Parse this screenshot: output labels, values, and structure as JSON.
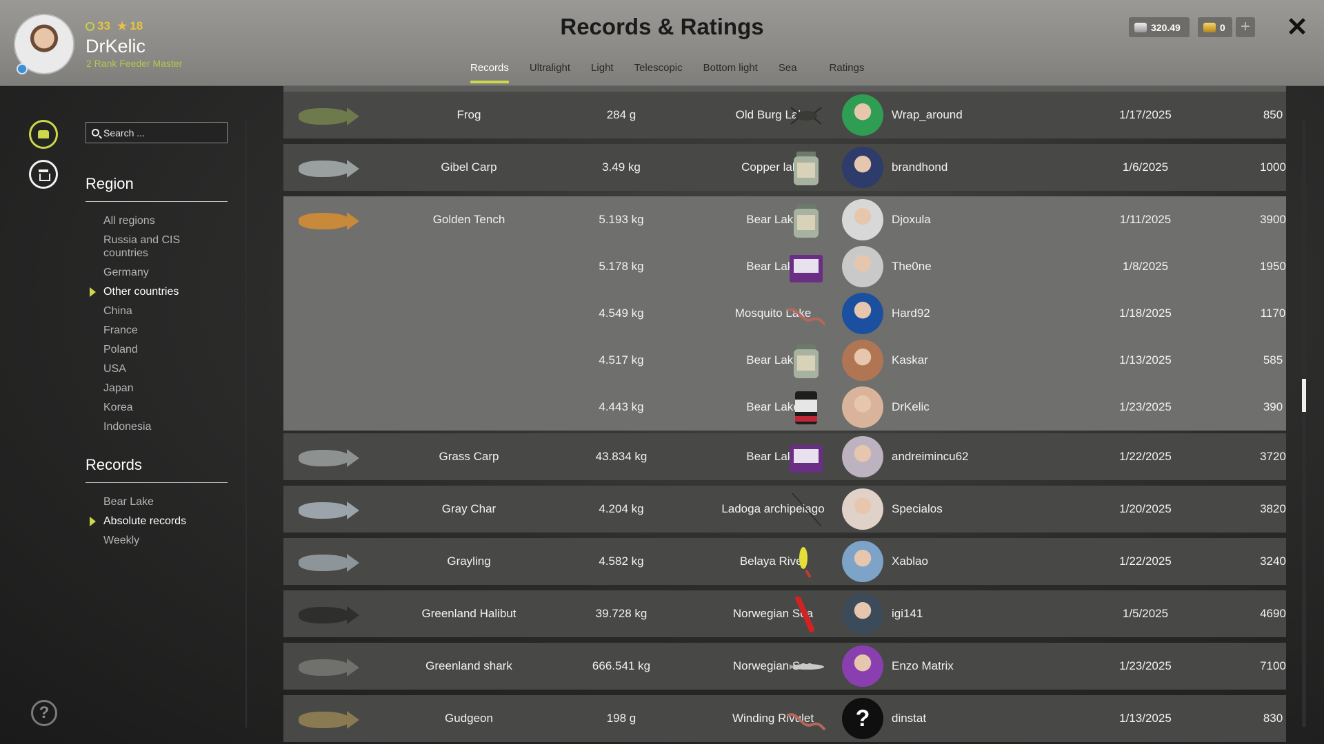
{
  "header": {
    "title": "Records & Ratings",
    "username": "DrKelic",
    "rank": "2 Rank Feeder Master",
    "level": "33",
    "stars": "18",
    "silver": "320.49",
    "gold": "0",
    "plus": "+",
    "close": "✕"
  },
  "tabs": [
    {
      "label": "Records",
      "active": true
    },
    {
      "label": "Ultralight"
    },
    {
      "label": "Light"
    },
    {
      "label": "Telescopic"
    },
    {
      "label": "Bottom light"
    },
    {
      "label": "Sea"
    },
    {
      "label": "Ratings"
    }
  ],
  "search": {
    "placeholder": "Search ..."
  },
  "region": {
    "heading": "Region",
    "items": [
      "All regions",
      "Russia and CIS countries",
      "Germany",
      "Other countries",
      "China",
      "France",
      "Poland",
      "USA",
      "Japan",
      "Korea",
      "Indonesia"
    ],
    "active": "Other countries"
  },
  "records_filter": {
    "heading": "Records",
    "items": [
      "Bear Lake",
      "Absolute records",
      "Weekly"
    ],
    "active": "Absolute records"
  },
  "help": "?",
  "rows": [
    {
      "fish": "Frog",
      "fish_color": "#6f7a4c",
      "entries": [
        {
          "weight": "284 g",
          "location": "Old Burg Lake",
          "user": "Wrap_around",
          "date": "1/17/2025",
          "points": "850",
          "lure": "bug",
          "avatar_color": "#2f9e52"
        }
      ]
    },
    {
      "fish": "Gibel Carp",
      "fish_color": "#9aa0a0",
      "entries": [
        {
          "weight": "3.49 kg",
          "location": "Copper lake",
          "user": "brandhond",
          "date": "1/6/2025",
          "points": "1000",
          "lure": "jar",
          "avatar_color": "#2d3c6a"
        }
      ]
    },
    {
      "fish": "Golden Tench",
      "fish_color": "#c8893a",
      "group": true,
      "entries": [
        {
          "weight": "5.193 kg",
          "location": "Bear Lake",
          "user": "Djoxula",
          "date": "1/11/2025",
          "points": "3900",
          "lure": "jar",
          "avatar_color": "#d8d8d8"
        },
        {
          "weight": "5.178 kg",
          "location": "Bear Lake",
          "user": "The0ne",
          "date": "1/8/2025",
          "points": "1950",
          "lure": "box",
          "avatar_color": "#c9c9c9"
        },
        {
          "weight": "4.549 kg",
          "location": "Mosquito Lake",
          "user": "Hard92",
          "date": "1/18/2025",
          "points": "1170",
          "lure": "worm",
          "avatar_color": "#1b4fa0"
        },
        {
          "weight": "4.517 kg",
          "location": "Bear Lake",
          "user": "Kaskar",
          "date": "1/13/2025",
          "points": "585",
          "lure": "jar",
          "avatar_color": "#b07654"
        },
        {
          "weight": "4.443 kg",
          "location": "Bear Lake",
          "user": "DrKelic",
          "date": "1/23/2025",
          "points": "390",
          "lure": "can",
          "avatar_color": "#d9b49a"
        }
      ]
    },
    {
      "fish": "Grass Carp",
      "fish_color": "#8d9190",
      "entries": [
        {
          "weight": "43.834 kg",
          "location": "Bear Lake",
          "user": "andreimincu62",
          "date": "1/22/2025",
          "points": "3720",
          "lure": "box",
          "avatar_color": "#bdb3c0"
        }
      ]
    },
    {
      "fish": "Gray Char",
      "fish_color": "#9aa4aa",
      "entries": [
        {
          "weight": "4.204 kg",
          "location": "Ladoga archipelago",
          "user": "Specialos",
          "date": "1/20/2025",
          "points": "3820",
          "lure": "line",
          "avatar_color": "#e0d2c8"
        }
      ]
    },
    {
      "fish": "Grayling",
      "fish_color": "#8e9598",
      "entries": [
        {
          "weight": "4.582 kg",
          "location": "Belaya River",
          "user": "Xablao",
          "date": "1/22/2025",
          "points": "3240",
          "lure": "spoon",
          "avatar_color": "#7da3c9"
        }
      ]
    },
    {
      "fish": "Greenland Halibut",
      "fish_color": "#2e2f2c",
      "entries": [
        {
          "weight": "39.728 kg",
          "location": "Norwegian Sea",
          "user": "igi141",
          "date": "1/5/2025",
          "points": "4690",
          "lure": "redlure",
          "avatar_color": "#3c4b5a"
        }
      ]
    },
    {
      "fish": "Greenland shark",
      "fish_color": "#70706c",
      "entries": [
        {
          "weight": "666.541 kg",
          "location": "Norwegian Sea",
          "user": "Enzo Matrix",
          "date": "1/23/2025",
          "points": "7100",
          "lure": "silverfish",
          "avatar_color": "#8a3fb0"
        }
      ]
    },
    {
      "fish": "Gudgeon",
      "fish_color": "#8a7a52",
      "entries": [
        {
          "weight": "198 g",
          "location": "Winding Rivulet",
          "user": "dinstat",
          "date": "1/13/2025",
          "points": "830",
          "lure": "worm",
          "avatar_color": "#101010",
          "avatar_text": "?"
        }
      ]
    }
  ]
}
